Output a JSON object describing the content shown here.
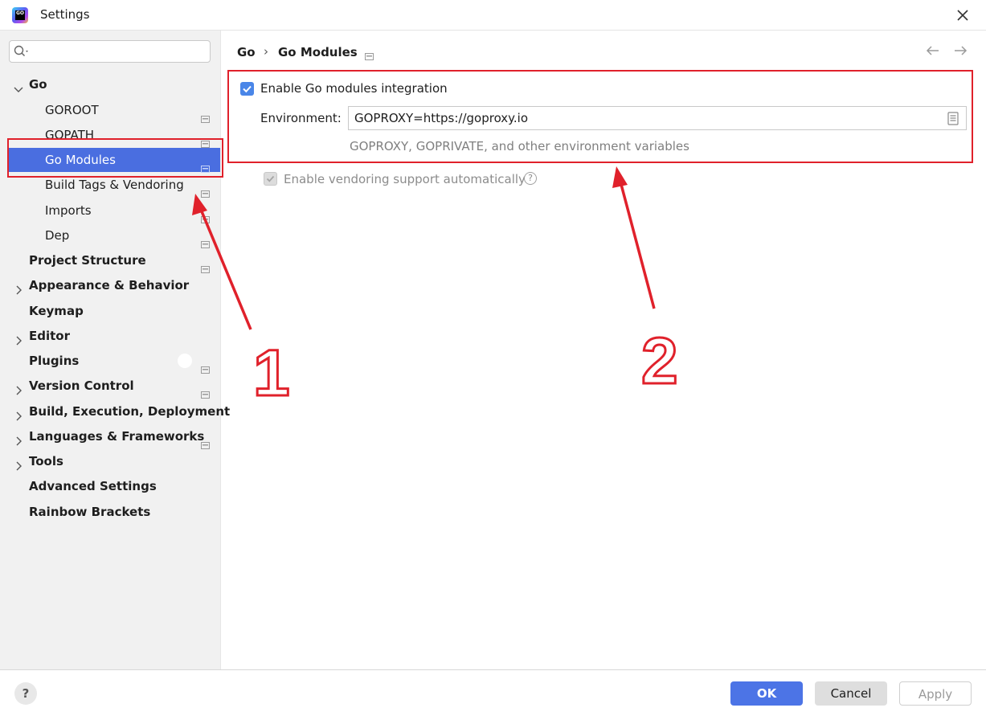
{
  "window": {
    "title": "Settings"
  },
  "search": {
    "placeholder": ""
  },
  "sidebar": {
    "items": [
      {
        "label": "Go",
        "expanded": true,
        "bold": true
      },
      {
        "label": "GOROOT"
      },
      {
        "label": "GOPATH"
      },
      {
        "label": "Go Modules",
        "selected": true
      },
      {
        "label": "Build Tags & Vendoring"
      },
      {
        "label": "Imports"
      },
      {
        "label": "Dep"
      },
      {
        "label": "Project Structure",
        "bold": true
      },
      {
        "label": "Appearance & Behavior",
        "bold": true,
        "expandable": true
      },
      {
        "label": "Keymap",
        "bold": true
      },
      {
        "label": "Editor",
        "bold": true,
        "expandable": true
      },
      {
        "label": "Plugins",
        "bold": true
      },
      {
        "label": "Version Control",
        "bold": true,
        "expandable": true
      },
      {
        "label": "Build, Execution, Deployment",
        "bold": true,
        "expandable": true
      },
      {
        "label": "Languages & Frameworks",
        "bold": true,
        "expandable": true
      },
      {
        "label": "Tools",
        "bold": true,
        "expandable": true
      },
      {
        "label": "Advanced Settings",
        "bold": true
      },
      {
        "label": "Rainbow Brackets",
        "bold": true
      }
    ]
  },
  "breadcrumb": {
    "parent": "Go",
    "separator": "›",
    "current": "Go Modules"
  },
  "main": {
    "modules_checkbox": {
      "label": "Enable Go modules integration",
      "checked": true
    },
    "environment": {
      "label": "Environment:",
      "value": "GOPROXY=https://goproxy.io",
      "hint": "GOPROXY, GOPRIVATE, and other environment variables"
    },
    "vendoring_checkbox": {
      "label": "Enable vendoring support automatically",
      "checked": true,
      "enabled": false
    },
    "vendoring_help": "?"
  },
  "annotations": {
    "label_1": "1",
    "label_2": "2",
    "color": "#e0212b"
  },
  "footer": {
    "help": "?",
    "ok": "OK",
    "cancel": "Cancel",
    "apply": "Apply"
  },
  "colors": {
    "selection": "#4a6ee0",
    "ok_button": "#4c74e6",
    "sidebar_bg": "#f1f1f1"
  }
}
